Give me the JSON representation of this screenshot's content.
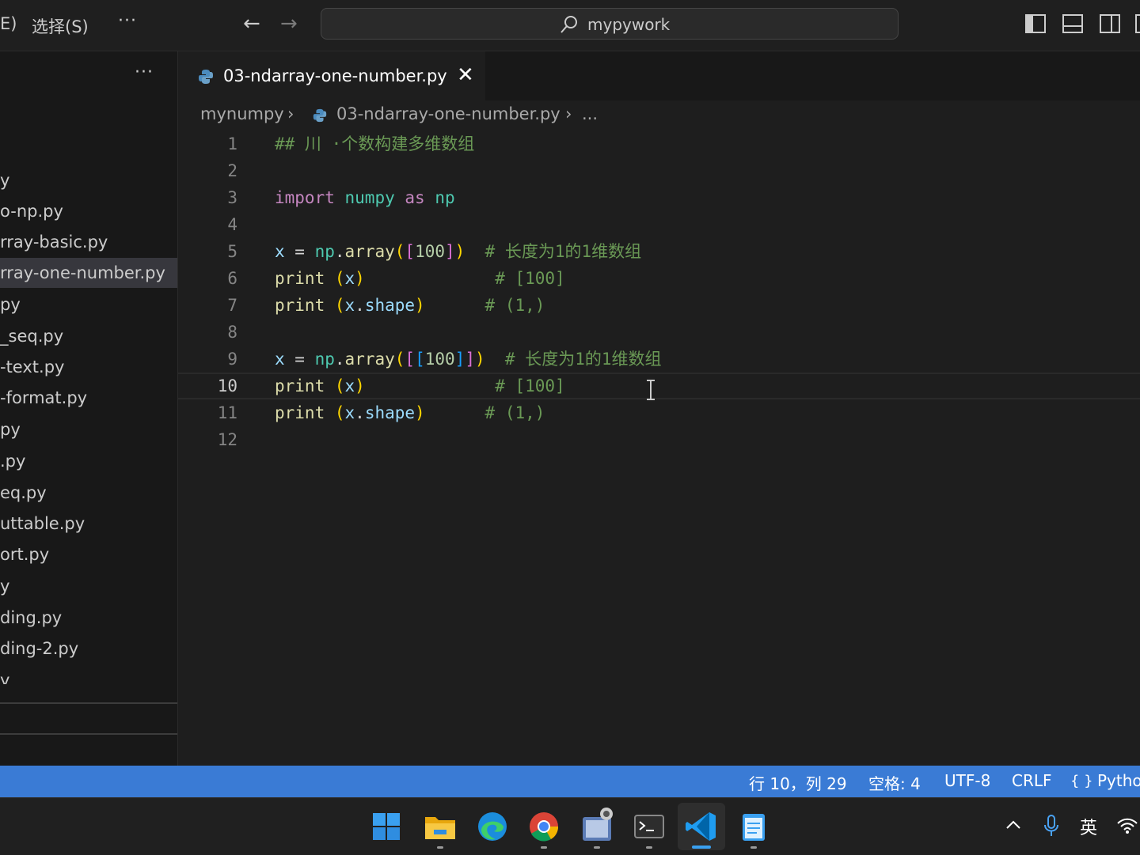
{
  "titlebar": {
    "menu_partial": "E)",
    "menu_select": "选择(S)",
    "more": "···",
    "back": "←",
    "forward": "→",
    "search_text": "mypywork"
  },
  "sidebar": {
    "more": "···",
    "files": [
      "y",
      "o-np.py",
      "rray-basic.py",
      "rray-one-number.py",
      "py",
      "_seq.py",
      "-text.py",
      "-format.py",
      "py",
      ".py",
      "eq.py",
      "uttable.py",
      "ort.py",
      "y",
      "ding.py",
      "ding-2.py",
      "y"
    ],
    "selected_index": 3
  },
  "tab": {
    "label": "03-ndarray-one-number.py",
    "close": "✕"
  },
  "breadcrumb": {
    "folder": "mynumpy",
    "sep": "›",
    "file": "03-ndarray-one-number.py",
    "more": "..."
  },
  "editor": {
    "line_numbers": [
      "1",
      "2",
      "3",
      "4",
      "5",
      "6",
      "7",
      "8",
      "9",
      "10",
      "11",
      "12"
    ],
    "active_line": "10",
    "lines": {
      "l1_comment": "## 川 ·个数构建多维数组",
      "l3_import": "import",
      "l3_numpy": "numpy",
      "l3_as": "as",
      "l3_np": "np",
      "l5_x": "x",
      "l5_eq": " = ",
      "l5_np": "np",
      "l5_dot": ".",
      "l5_array": "array",
      "l5_p1": "(",
      "l5_b1": "[",
      "l5_num": "100",
      "l5_b2": "]",
      "l5_p2": ")",
      "l5_comment": "  # 长度为1的1维数组",
      "l6_print": "print",
      "l6_open": " (",
      "l6_x": "x",
      "l6_close": ")",
      "l6_comment": "             # [100]",
      "l7_print": "print",
      "l7_open": " (",
      "l7_x": "x",
      "l7_dot": ".",
      "l7_shape": "shape",
      "l7_close": ")",
      "l7_comment": "      # (1,)",
      "l9_x": "x",
      "l9_eq": " = ",
      "l9_np": "np",
      "l9_dot": ".",
      "l9_array": "array",
      "l9_p1": "(",
      "l9_b1": "[",
      "l9_b2": "[",
      "l9_num": "100",
      "l9_b3": "]",
      "l9_b4": "]",
      "l9_p2": ")",
      "l9_comment": "  # 长度为1的1维数组",
      "l10_print": "print",
      "l10_open": " (",
      "l10_x": "x",
      "l10_close": ")",
      "l10_comment": "             # [100]",
      "l11_print": "print",
      "l11_open": " (",
      "l11_x": "x",
      "l11_dot": ".",
      "l11_shape": "shape",
      "l11_close": ")",
      "l11_comment": "      # (1,)"
    }
  },
  "statusbar": {
    "position": "行 10，列 29",
    "indent": "空格: 4",
    "encoding": "UTF-8",
    "eol": "CRLF",
    "language_icon": "{ }",
    "language": "Pytho"
  },
  "taskbar": {
    "ime": "英",
    "tray_up": "^"
  },
  "colors": {
    "statusbar": "#3a7bd5",
    "editor_bg": "#1e1e1e",
    "sidebar_bg": "#181818"
  }
}
